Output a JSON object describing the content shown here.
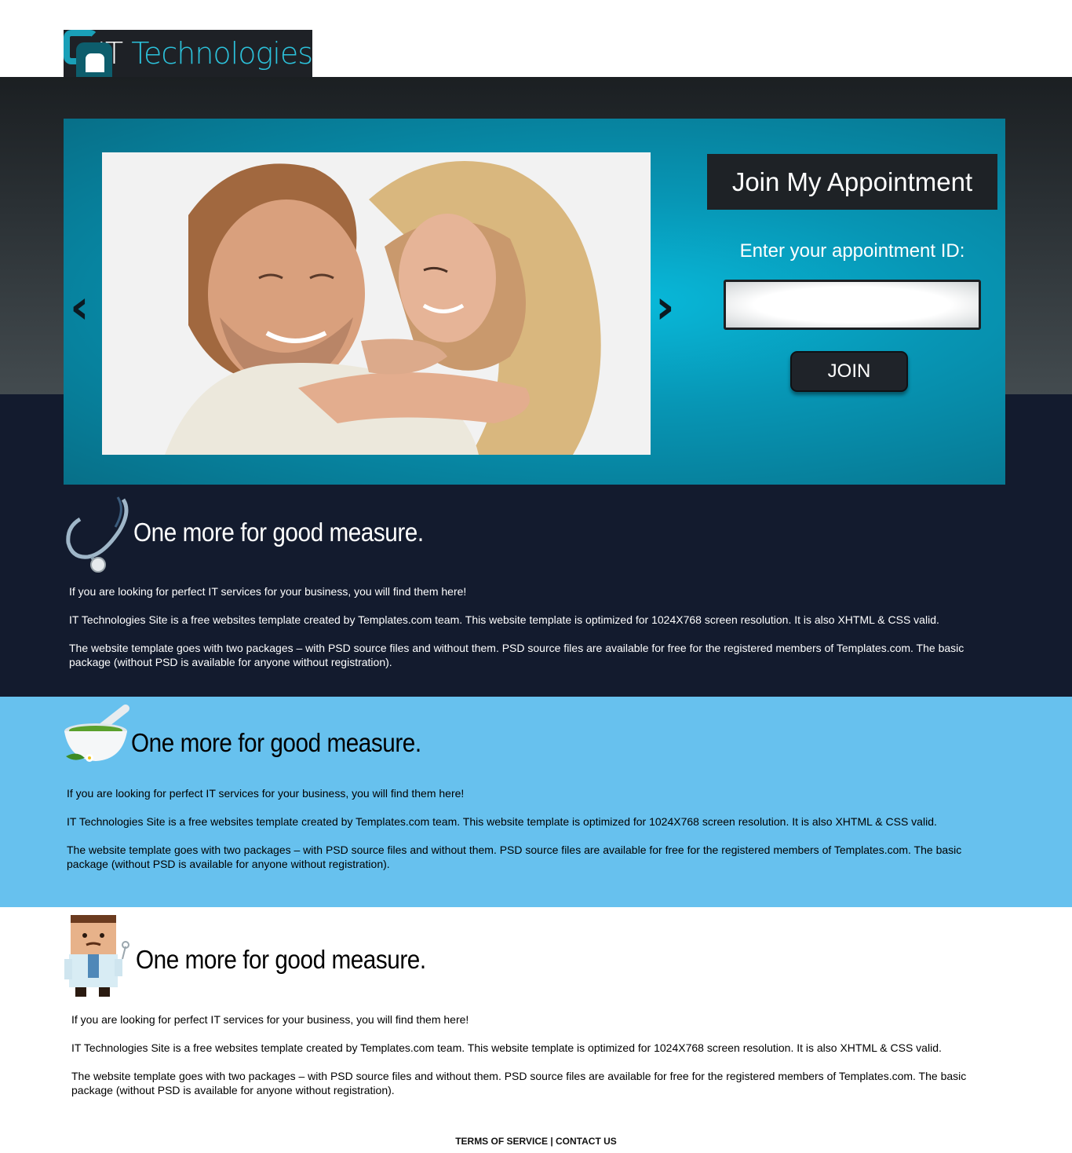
{
  "header": {
    "logo_it": "IT",
    "logo_tech": " Technologies"
  },
  "hero": {
    "prev_glyph": "‹",
    "next_glyph": "›",
    "title": "Join My Appointment",
    "label": "Enter your appointment ID:",
    "input_value": "",
    "join_label": "JOIN"
  },
  "sections": [
    {
      "icon": "stethoscope-icon",
      "title": "One more for good measure.",
      "paragraphs": [
        "If you are looking for perfect IT services for your business, you will find them here!",
        "IT Technologies Site is a free websites template created by Templates.com team. This website template is optimized for 1024X768 screen resolution. It is also XHTML & CSS valid.",
        "The website template goes with two packages – with PSD source files and without them. PSD source files are available for free for the registered members of Templates.com. The basic package (without PSD is available for anyone without registration)."
      ]
    },
    {
      "icon": "mortar-pestle-icon",
      "title": "One more for good measure.",
      "paragraphs": [
        "If you are looking for perfect IT services for your business, you will find them here!",
        "IT Technologies Site is a free websites template created by Templates.com team. This website template is optimized for 1024X768 screen resolution. It is also XHTML & CSS valid.",
        "The website template goes with two packages – with PSD source files and without them. PSD source files are available for free for the registered members of Templates.com. The basic package (without PSD is available for anyone without registration)."
      ]
    },
    {
      "icon": "doctor-icon",
      "title": "One more for good measure.",
      "paragraphs": [
        "If you are looking for perfect IT services for your business, you will find them here!",
        "IT Technologies Site is a free websites template created by Templates.com team. This website template is optimized for 1024X768 screen resolution. It is also XHTML & CSS valid.",
        "The website template goes with two packages – with PSD source files and without them. PSD source files are available for free for the registered members of Templates.com. The basic package (without PSD is available for anyone without registration)."
      ]
    }
  ],
  "footer": {
    "terms": "TERMS OF SERVICE",
    "separator": " | ",
    "contact": "CONTACT US"
  }
}
